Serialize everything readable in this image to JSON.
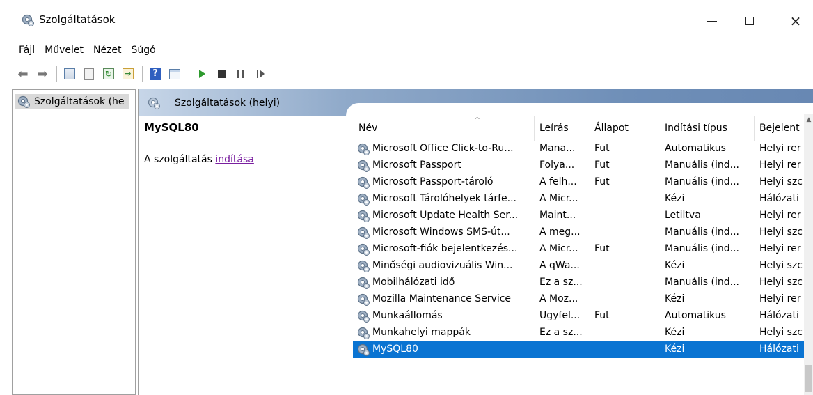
{
  "window": {
    "title": "Szolgáltatások",
    "controls": {
      "minimize": "minimize-icon",
      "maximize": "maximize-icon",
      "close": "×"
    }
  },
  "menu": [
    "Fájl",
    "Művelet",
    "Nézet",
    "Súgó"
  ],
  "toolbar": [
    "back-icon",
    "forward-icon",
    "show-console-tree-icon",
    "properties-icon",
    "refresh-icon",
    "export-list-icon",
    "help-icon",
    "show-action-pane-icon",
    "start-service-icon",
    "stop-service-icon",
    "pause-service-icon",
    "resume-service-icon"
  ],
  "tree": {
    "item": "Szolgáltatások (he"
  },
  "pane": {
    "header": "Szolgáltatások (helyi)",
    "selected_name": "MySQL80",
    "action_prefix": "A szolgáltatás ",
    "action_link": "indítása"
  },
  "list": {
    "columns": {
      "name": "Név",
      "desc": "Leírás",
      "status": "Állapot",
      "start": "Indítási típus",
      "logon": "Bejelent"
    },
    "rows": [
      {
        "name": "Microsoft Office Click-to-Ru...",
        "desc": "Mana...",
        "status": "Fut",
        "start": "Automatikus",
        "logon": "Helyi rer"
      },
      {
        "name": "Microsoft Passport",
        "desc": "Folya...",
        "status": "Fut",
        "start": "Manuális (ind...",
        "logon": "Helyi rer"
      },
      {
        "name": "Microsoft Passport-tároló",
        "desc": "A felh...",
        "status": "Fut",
        "start": "Manuális (ind...",
        "logon": "Helyi szc"
      },
      {
        "name": "Microsoft Tárolóhelyek tárfe...",
        "desc": "A Micr...",
        "status": "",
        "start": "Kézi",
        "logon": "Hálózati"
      },
      {
        "name": "Microsoft Update Health Ser...",
        "desc": "Maint...",
        "status": "",
        "start": "Letiltva",
        "logon": "Helyi rer"
      },
      {
        "name": "Microsoft Windows SMS-út...",
        "desc": "A meg...",
        "status": "",
        "start": "Manuális (ind...",
        "logon": "Helyi szc"
      },
      {
        "name": "Microsoft-fiók bejelentkezés...",
        "desc": "A Micr...",
        "status": "Fut",
        "start": "Manuális (ind...",
        "logon": "Helyi rer"
      },
      {
        "name": "Minőségi audiovizuális Win...",
        "desc": "A qWa...",
        "status": "",
        "start": "Kézi",
        "logon": "Helyi szc"
      },
      {
        "name": "Mobilhálózati idő",
        "desc": "Ez a sz...",
        "status": "",
        "start": "Manuális (ind...",
        "logon": "Helyi szc"
      },
      {
        "name": "Mozilla Maintenance Service",
        "desc": "A Moz...",
        "status": "",
        "start": "Kézi",
        "logon": "Helyi rer"
      },
      {
        "name": "Munkaállomás",
        "desc": "Ügyfel...",
        "status": "Fut",
        "start": "Automatikus",
        "logon": "Hálózati"
      },
      {
        "name": "Munkahelyi mappák",
        "desc": "Ez a sz...",
        "status": "",
        "start": "Kézi",
        "logon": "Helyi szc"
      },
      {
        "name": "MySQL80",
        "desc": "",
        "status": "",
        "start": "Kézi",
        "logon": "Hálózati",
        "selected": true
      }
    ]
  },
  "colors": {
    "selection": "#0a74d2",
    "link": "#7a1fa0",
    "header_gradient_end": "#6888b3"
  }
}
